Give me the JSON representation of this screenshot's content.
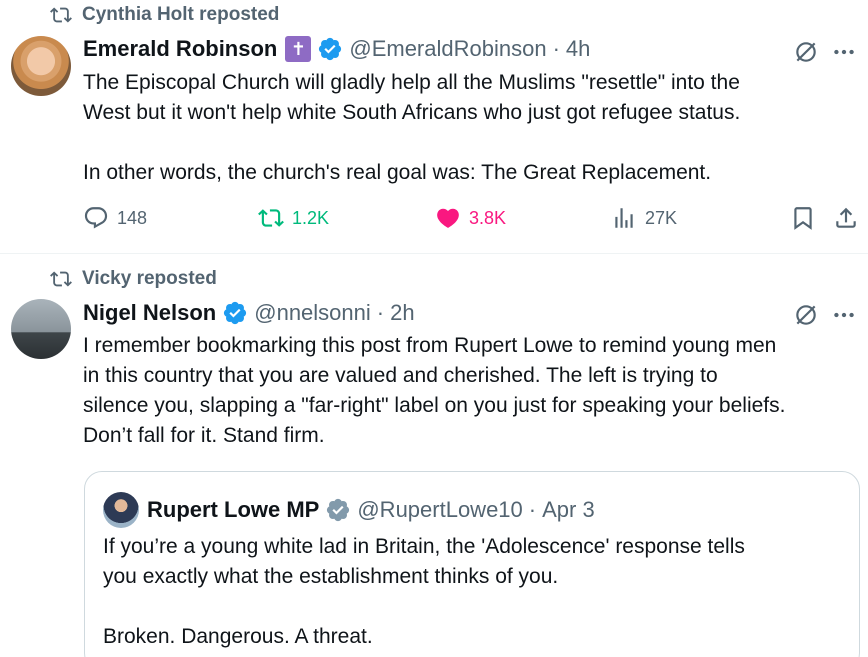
{
  "posts": [
    {
      "reposted_by": "Cynthia Holt reposted",
      "author": {
        "name": "Emerald Robinson",
        "handle": "@EmeraldRobinson",
        "time": "4h",
        "verified": true,
        "badge": "✝"
      },
      "text_lines": [
        "The Episcopal Church will gladly help all the Muslims \"resettle\" into the",
        "West but it won't help white South Africans who just got refugee status.",
        "",
        "In other words, the church's real goal was: The Great Replacement."
      ],
      "stats": {
        "replies": "148",
        "reposts": "1.2K",
        "likes": "3.8K",
        "views": "27K"
      }
    },
    {
      "reposted_by": "Vicky reposted",
      "author": {
        "name": "Nigel Nelson",
        "handle": "@nnelsonni",
        "time": "2h",
        "verified": true
      },
      "text_lines": [
        "I remember bookmarking this post from Rupert Lowe to remind young men",
        "in this country that you are valued and cherished. The left is trying to",
        "silence you, slapping a \"far-right\" label on you just for speaking your beliefs.",
        "Don’t fall for it. Stand firm."
      ],
      "quote": {
        "name": "Rupert Lowe MP",
        "handle": "@RupertLowe10",
        "time": "Apr 3",
        "text_lines": [
          "If you’re a young white lad in Britain, the  'Adolescence' response tells",
          "you exactly what the establishment thinks of you.",
          "",
          "Broken. Dangerous. A threat."
        ]
      }
    }
  ],
  "colors": {
    "text": "#0f1419",
    "secondary": "#536471",
    "verified_blue": "#1d9bf0",
    "verified_gray": "#829aab",
    "retweet_green": "#00ba7c",
    "like_pink": "#f91880",
    "cross_badge": "#8e6bc4"
  },
  "icons": [
    "repost-icon",
    "verified-badge-icon",
    "grok-icon",
    "more-icon",
    "reply-icon",
    "retweet-icon",
    "heart-icon",
    "views-icon",
    "bookmark-icon",
    "share-icon"
  ]
}
